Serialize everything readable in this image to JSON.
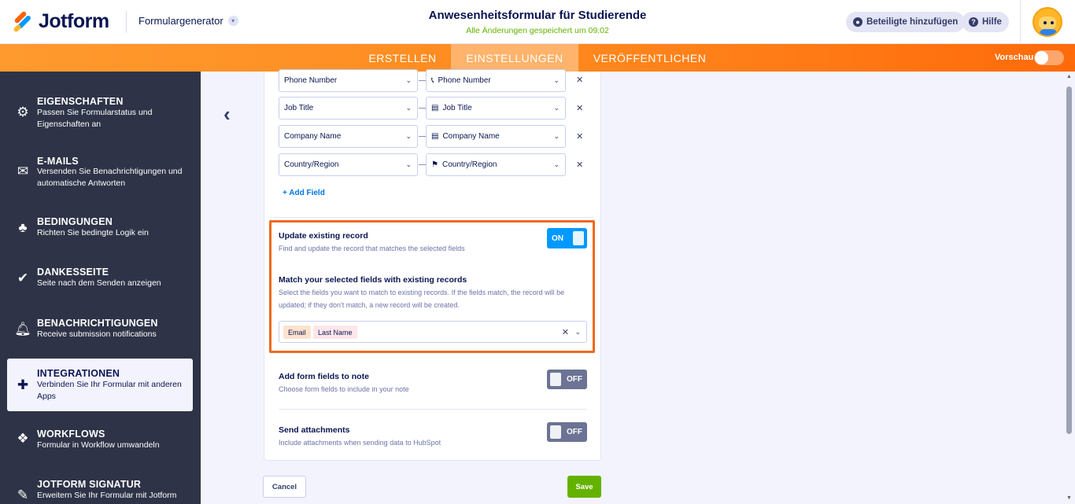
{
  "header": {
    "logo_text": "Jotform",
    "form_builder": "Formulargenerator",
    "form_title": "Anwesenheitsformular für Studierende",
    "save_status": "Alle Änderungen gespeichert um 09:02",
    "invite_label": "Beteiligte hinzufügen",
    "help_label": "Hilfe"
  },
  "nav": {
    "tabs": [
      {
        "label": "ERSTELLEN"
      },
      {
        "label": "EINSTELLUNGEN"
      },
      {
        "label": "VERÖFFENTLICHEN"
      }
    ],
    "active_tab": "EINSTELLUNGEN",
    "preview_label": "Vorschau"
  },
  "sidebar": {
    "items": [
      {
        "title": "EIGENSCHAFTEN",
        "desc": "Passen Sie Formularstatus und Eigenschaften an",
        "icon": "gear-icon"
      },
      {
        "title": "E-MAILS",
        "desc": "Versenden Sie Benachrichtigungen und automatische Antworten",
        "icon": "envelope-icon"
      },
      {
        "title": "BEDINGUNGEN",
        "desc": "Richten Sie bedingte Logik ein",
        "icon": "hierarchy-icon"
      },
      {
        "title": "DANKESSEITE",
        "desc": "Seite nach dem Senden anzeigen",
        "icon": "check-circle-icon"
      },
      {
        "title": "BENACHRICHTIGUNGEN",
        "desc": "Receive submission notifications",
        "icon": "bell-icon"
      },
      {
        "title": "INTEGRATIONEN",
        "desc": "Verbinden Sie Ihr Formular mit anderen Apps",
        "icon": "puzzle-icon"
      },
      {
        "title": "WORKFLOWS",
        "desc": "Formular in Workflow umwandeln",
        "icon": "workflow-icon"
      },
      {
        "title": "JOTFORM SIGNATUR",
        "desc": "Erweitern Sie Ihr Formular mit Jotform",
        "icon": "pen-icon"
      }
    ],
    "active": "INTEGRATIONEN"
  },
  "mapping": {
    "rows": [
      {
        "form_field": "Phone Number",
        "hubspot_field": "Phone Number",
        "icon": "phone-icon"
      },
      {
        "form_field": "Job Title",
        "hubspot_field": "Job Title",
        "icon": "id-card-icon"
      },
      {
        "form_field": "Company Name",
        "hubspot_field": "Company Name",
        "icon": "id-card-icon"
      },
      {
        "form_field": "Country/Region",
        "hubspot_field": "Country/Region",
        "icon": "flag-icon"
      }
    ],
    "add_field_label": "+ Add Field"
  },
  "update_record": {
    "label": "Update existing record",
    "desc": "Find and update the record that matches the selected fields",
    "toggle": "ON",
    "match_label": "Match your selected fields with existing records",
    "match_desc": "Select the fields you want to match to existing records. If the fields match, the record will be updated; if they don't match, a new record will be created.",
    "tags": [
      {
        "label": "Email",
        "color": "#fde3cf"
      },
      {
        "label": "Last Name",
        "color": "#fde6ea"
      }
    ]
  },
  "note_fields": {
    "label": "Add form fields to note",
    "desc": "Choose form fields to include in your note",
    "toggle": "OFF"
  },
  "attachments": {
    "label": "Send attachments",
    "desc": "Include attachments when sending data to HubSpot",
    "toggle": "OFF"
  },
  "buttons": {
    "cancel": "Cancel",
    "save": "Save"
  },
  "colors": {
    "accent_orange": "#ff6100",
    "toggle_on": "#0099ff",
    "save_green": "#64b200",
    "highlight": "#ef6a1c"
  }
}
